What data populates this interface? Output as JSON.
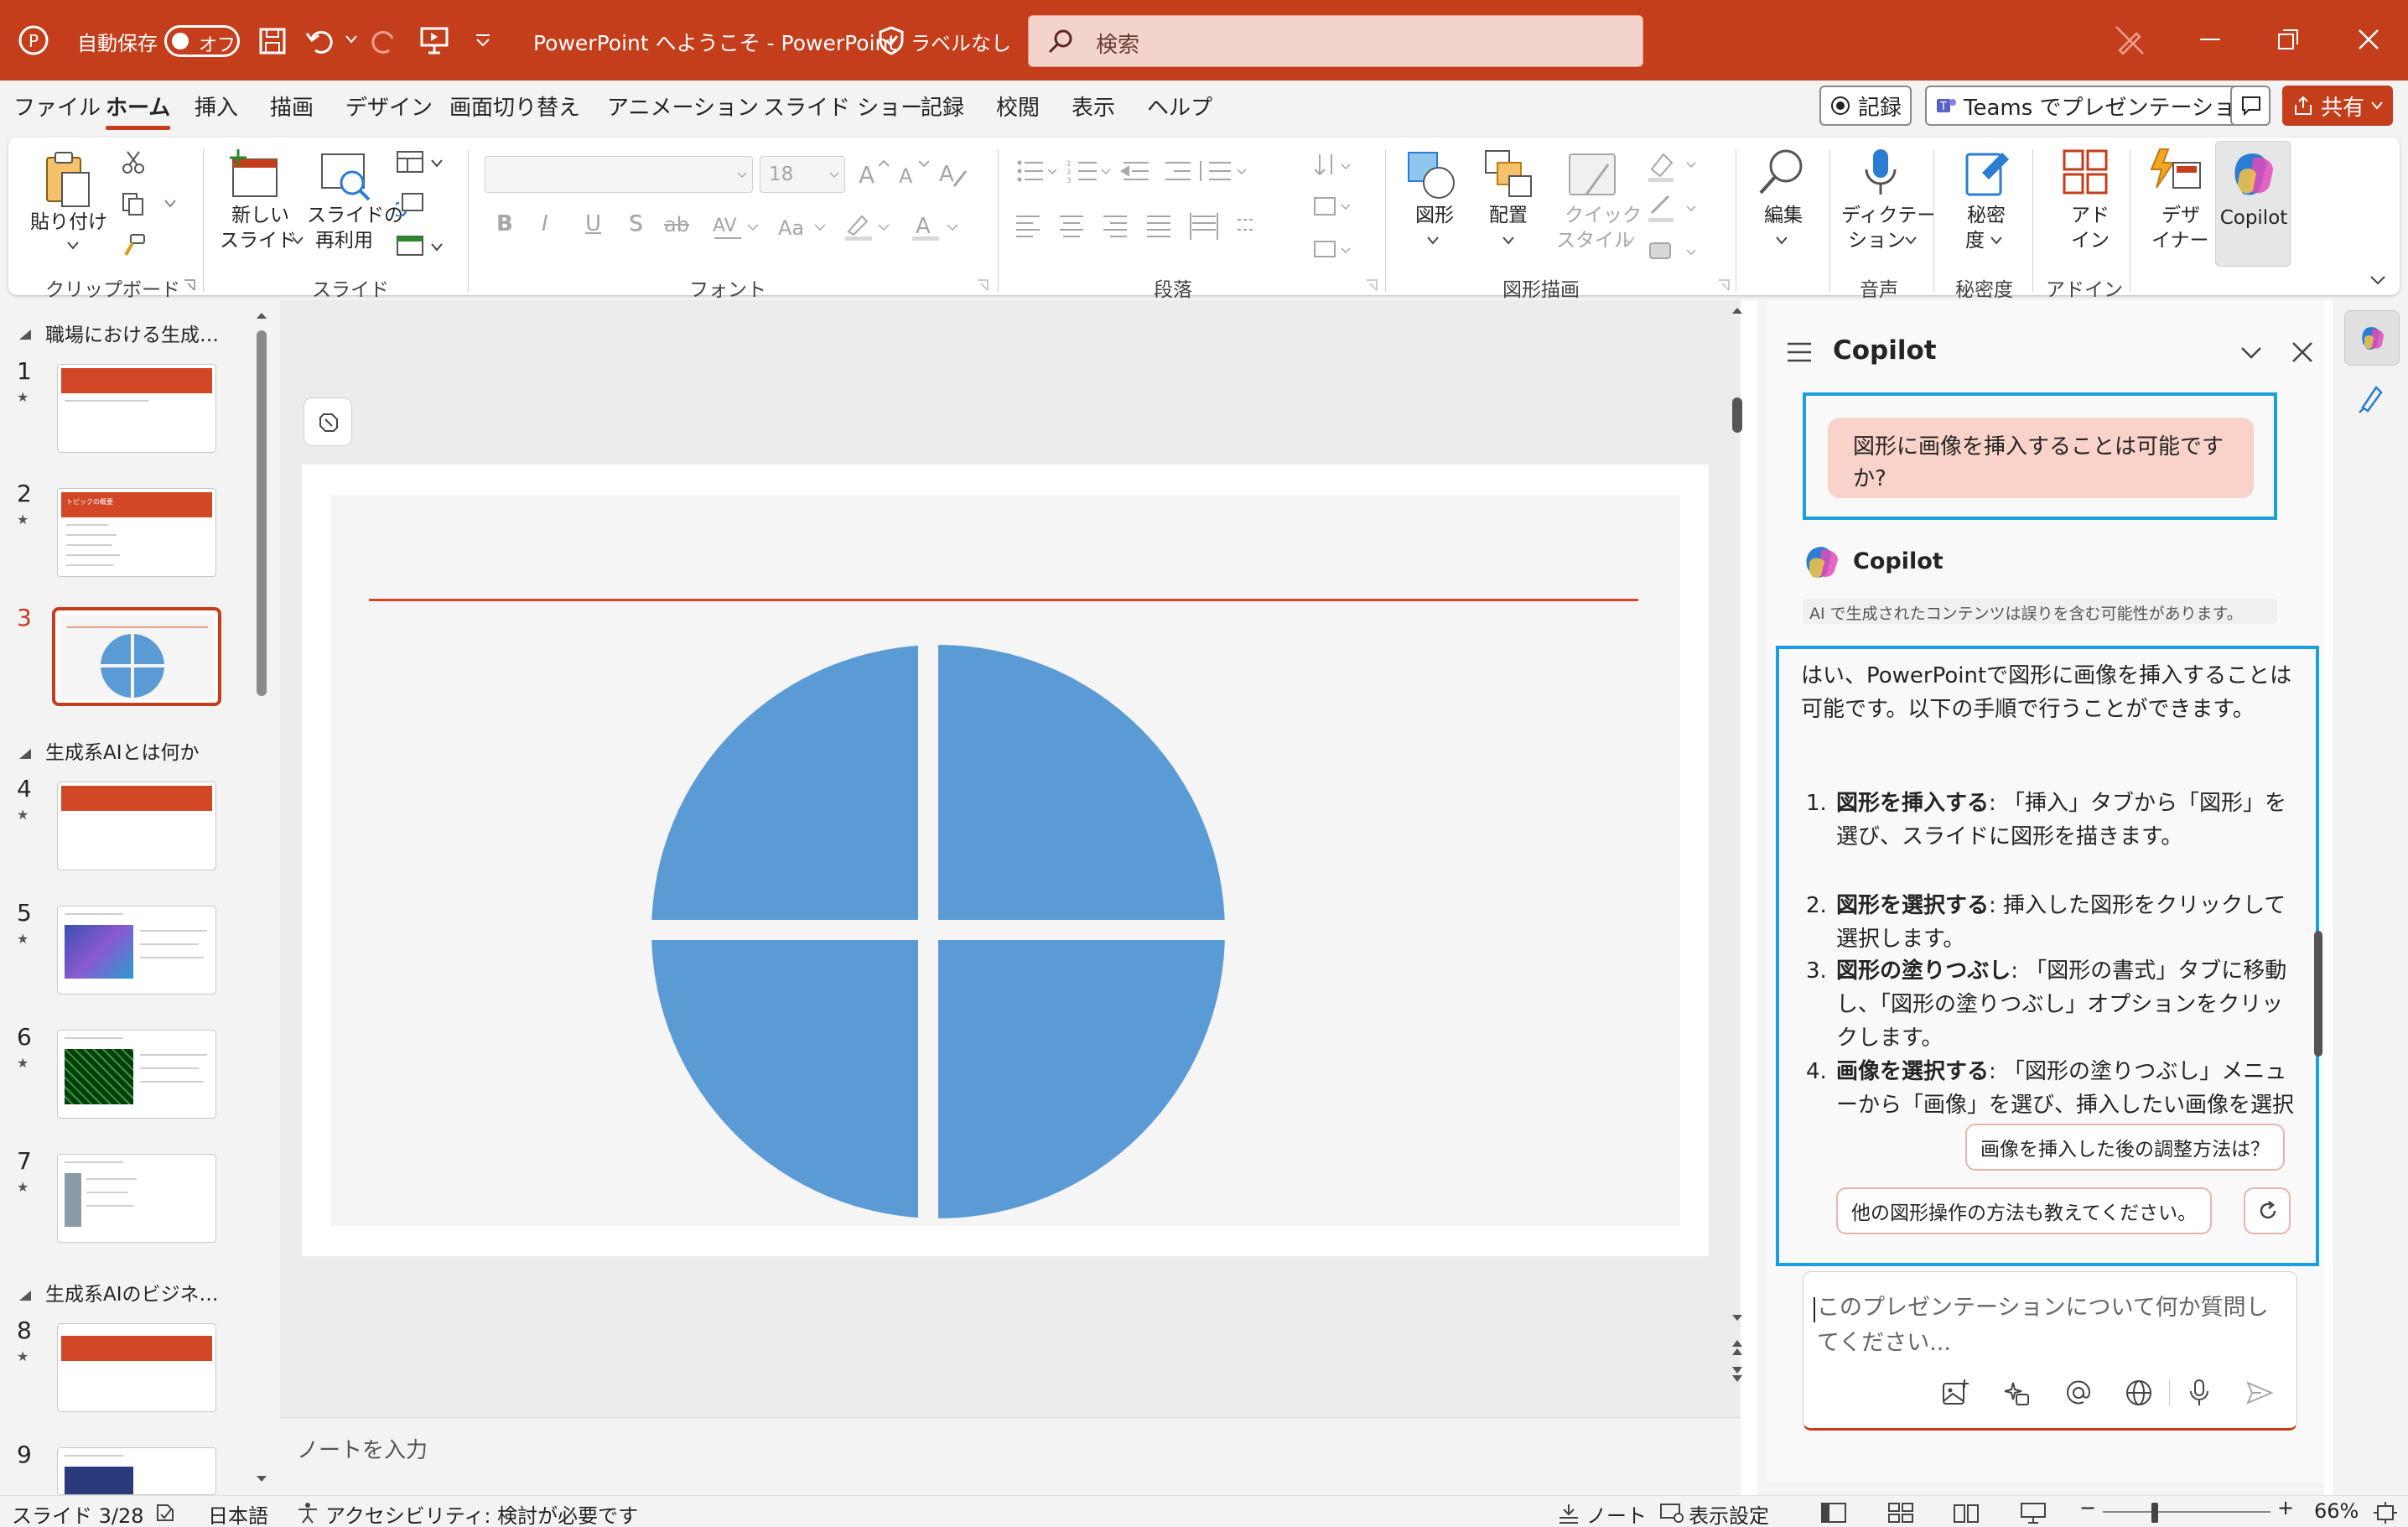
{
  "titlebar": {
    "autosave_label": "自動保存",
    "autosave_state": "オフ",
    "doc_title": "PowerPoint へようこそ  -  PowerPoint",
    "label_text": "ラベルなし",
    "search_placeholder": "検索"
  },
  "menu": {
    "items": [
      "ファイル",
      "ホーム",
      "挿入",
      "描画",
      "デザイン",
      "画面切り替え",
      "アニメーション",
      "スライド ショー",
      "記録",
      "校閲",
      "表示",
      "ヘルプ"
    ],
    "active": "ホーム",
    "record_button": "記録",
    "teams_button": "Teams でプレゼンテーション",
    "share_button": "共有"
  },
  "ribbon": {
    "clipboard": {
      "paste": "貼り付け",
      "group": "クリップボード"
    },
    "slides": {
      "new_slide_1": "新しい",
      "new_slide_2": "スライド",
      "reuse_1": "スライドの",
      "reuse_2": "再利用",
      "group": "スライド"
    },
    "font": {
      "size": "18",
      "bold": "B",
      "italic": "I",
      "underline": "U",
      "shadow": "S",
      "strike": "ab",
      "group": "フォント"
    },
    "paragraph": {
      "group": "段落"
    },
    "drawing": {
      "shape": "図形",
      "arrange": "配置",
      "quick_style_1": "クイック",
      "quick_style_2": "スタイル",
      "group": "図形描画"
    },
    "editing": {
      "label": "編集"
    },
    "voice": {
      "dictate_1": "ディクテー",
      "dictate_2": "ション",
      "group": "音声"
    },
    "sensitivity": {
      "label_1": "秘密",
      "label_2": "度",
      "group": "秘密度"
    },
    "addins": {
      "label_1": "アド",
      "label_2": "イン",
      "group": "アドイン"
    },
    "designer": {
      "label_1": "デザ",
      "label_2": "イナー"
    },
    "copilot": {
      "label": "Copilot"
    }
  },
  "slides_panel": {
    "sections": [
      "職場における生成…",
      "生成系AIとは何か",
      "生成系AIのビジネ…"
    ],
    "slides": [
      {
        "num": "1"
      },
      {
        "num": "2",
        "title": "トピックの概要"
      },
      {
        "num": "3"
      },
      {
        "num": "4"
      },
      {
        "num": "5"
      },
      {
        "num": "6"
      },
      {
        "num": "7"
      },
      {
        "num": "8"
      },
      {
        "num": "9"
      }
    ]
  },
  "notes": {
    "placeholder": "ノートを入力"
  },
  "copilot": {
    "title": "Copilot",
    "user_message": "図形に画像を挿入することは可能ですか?",
    "bot_name": "Copilot",
    "disclaimer": "AI で生成されたコンテンツは誤りを含む可能性があります。",
    "response_intro": "はい、PowerPointで図形に画像を挿入することは可能です。以下の手順で行うことができます。",
    "steps": [
      {
        "num": "1.",
        "bold": "図形を挿入する",
        "text": ": 「挿入」タブから「図形」を選び、スライドに図形を描きます。"
      },
      {
        "num": "2.",
        "bold": "図形を選択する",
        "text": ": 挿入した図形をクリックして選択します。"
      },
      {
        "num": "3.",
        "bold": "図形の塗りつぶし",
        "text": ": 「図形の書式」タブに移動し、「図形の塗りつぶし」オプションをクリックします。"
      },
      {
        "num": "4.",
        "bold": "画像を選択する",
        "text": ": 「図形の塗りつぶし」メニューから「画像」を選び、挿入したい画像を選択します。"
      }
    ],
    "suggestions": [
      "画像を挿入した後の調整方法は？",
      "他の図形操作の方法も教えてください。"
    ],
    "input_placeholder": "このプレゼンテーションについて何か質問してください..."
  },
  "status": {
    "slide_info": "スライド 3/28",
    "language": "日本語",
    "accessibility": "アクセシビリティ: 検討が必要です",
    "notes": "ノート",
    "display_settings": "表示設定",
    "zoom": "66%"
  },
  "colors": {
    "brand": "#c43e1c",
    "shape_fill": "#5b9bd5",
    "accent_blue": "#1a9fe0"
  }
}
